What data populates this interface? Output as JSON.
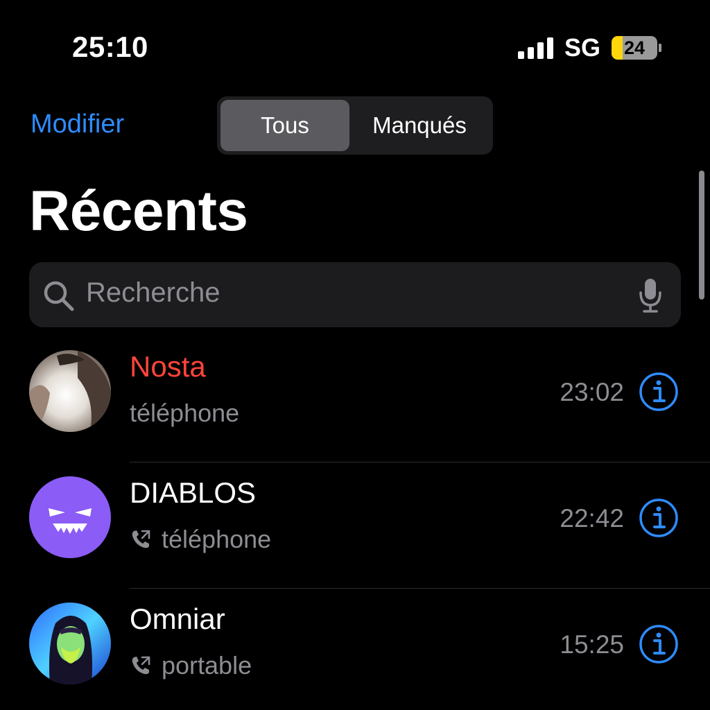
{
  "status_bar": {
    "time": "25:10",
    "carrier": "SG",
    "battery_level": "24",
    "battery_fraction": 0.24
  },
  "nav": {
    "edit_label": "Modifier",
    "segments": [
      "Tous",
      "Manqués"
    ],
    "selected_segment": "Tous"
  },
  "title": "Récents",
  "search": {
    "placeholder": "Recherche"
  },
  "calls": [
    {
      "name": "Nosta",
      "type": "téléphone",
      "time": "23:02",
      "missed": true,
      "outgoing": false
    },
    {
      "name": "DIABLOS",
      "type": "téléphone",
      "time": "22:42",
      "missed": false,
      "outgoing": true
    },
    {
      "name": "Omniar",
      "type": "portable",
      "time": "15:25",
      "missed": false,
      "outgoing": true
    }
  ],
  "colors": {
    "accent": "#2f8cff",
    "missed": "#ff453a",
    "secondary_text": "#8d8d93",
    "battery_low": "#ffd60a",
    "diablos_avatar": "#8b5cf6"
  },
  "icons": [
    "signal-icon",
    "battery-icon",
    "search-icon",
    "microphone-icon",
    "info-icon",
    "outgoing-call-icon"
  ]
}
